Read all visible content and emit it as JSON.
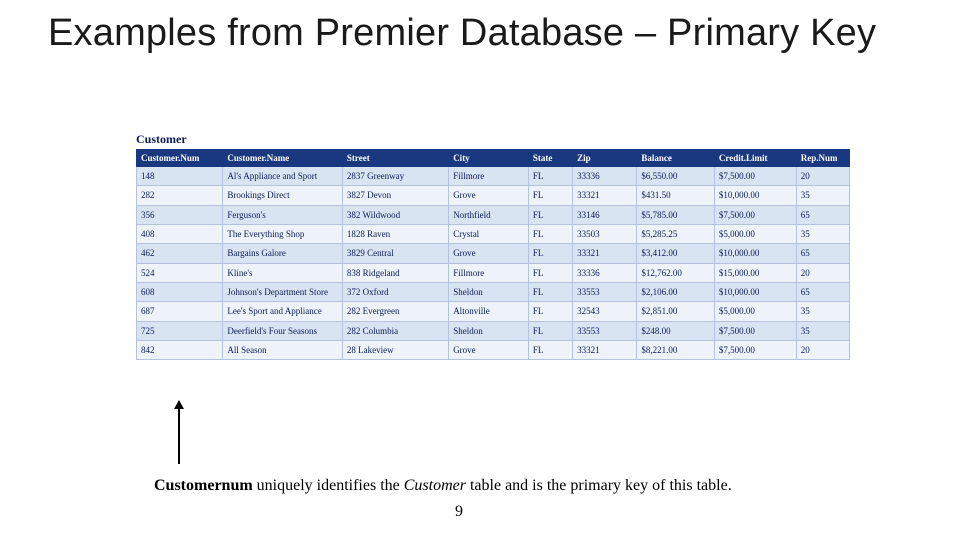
{
  "title": "Examples from Premier Database – Primary Key",
  "tableLabel": "Customer",
  "headers": [
    "Customer.Num",
    "Customer.Name",
    "Street",
    "City",
    "State",
    "Zip",
    "Balance",
    "Credit.Limit",
    "Rep.Num"
  ],
  "rows": [
    {
      "num": "148",
      "name": "Al's Appliance and Sport",
      "street": "2837 Greenway",
      "city": "Fillmore",
      "state": "FL",
      "zip": "33336",
      "bal": "$6,550.00",
      "cred": "$7,500.00",
      "rep": "20"
    },
    {
      "num": "282",
      "name": "Brookings Direct",
      "street": "3827 Devon",
      "city": "Grove",
      "state": "FL",
      "zip": "33321",
      "bal": "$431.50",
      "cred": "$10,000.00",
      "rep": "35"
    },
    {
      "num": "356",
      "name": "Ferguson's",
      "street": "382 Wildwood",
      "city": "Northfield",
      "state": "FL",
      "zip": "33146",
      "bal": "$5,785.00",
      "cred": "$7,500.00",
      "rep": "65"
    },
    {
      "num": "408",
      "name": "The Everything Shop",
      "street": "1828 Raven",
      "city": "Crystal",
      "state": "FL",
      "zip": "33503",
      "bal": "$5,285.25",
      "cred": "$5,000.00",
      "rep": "35"
    },
    {
      "num": "462",
      "name": "Bargains Galore",
      "street": "3829 Central",
      "city": "Grove",
      "state": "FL",
      "zip": "33321",
      "bal": "$3,412.00",
      "cred": "$10,000.00",
      "rep": "65"
    },
    {
      "num": "524",
      "name": "Kline's",
      "street": "838 Ridgeland",
      "city": "Fillmore",
      "state": "FL",
      "zip": "33336",
      "bal": "$12,762.00",
      "cred": "$15,000.00",
      "rep": "20"
    },
    {
      "num": "608",
      "name": "Johnson's Department Store",
      "street": "372 Oxford",
      "city": "Sheldon",
      "state": "FL",
      "zip": "33553",
      "bal": "$2,106.00",
      "cred": "$10,000.00",
      "rep": "65"
    },
    {
      "num": "687",
      "name": "Lee's Sport and Appliance",
      "street": "282 Evergreen",
      "city": "Altonville",
      "state": "FL",
      "zip": "32543",
      "bal": "$2,851.00",
      "cred": "$5,000.00",
      "rep": "35"
    },
    {
      "num": "725",
      "name": "Deerfield's Four Seasons",
      "street": "282 Columbia",
      "city": "Sheldon",
      "state": "FL",
      "zip": "33553",
      "bal": "$248.00",
      "cred": "$7,500.00",
      "rep": "35"
    },
    {
      "num": "842",
      "name": "All Season",
      "street": "28 Lakeview",
      "city": "Grove",
      "state": "FL",
      "zip": "33321",
      "bal": "$8,221.00",
      "cred": "$7,500.00",
      "rep": "20"
    }
  ],
  "caption": {
    "b": "Customernum",
    "mid": " uniquely identifies the ",
    "i": "Customer",
    "end": " table and is the primary key of this table."
  },
  "pageNumber": "9"
}
